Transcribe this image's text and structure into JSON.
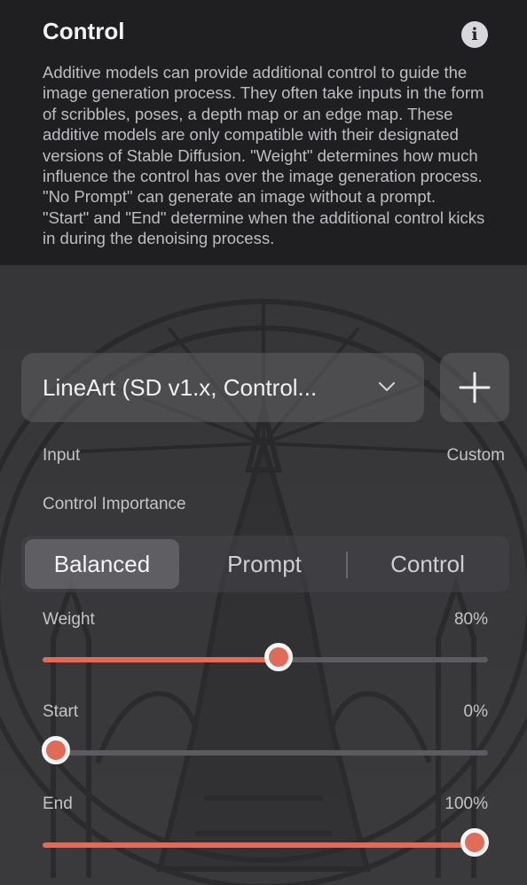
{
  "header": {
    "title": "Control",
    "info_icon": "info-icon",
    "info_glyph": "i"
  },
  "description": "Additive models can provide additional control to guide the image generation process. They often take inputs in the form of scribbles, poses, a depth map or an edge map. These additive models are only compatible with their designated versions of Stable Diffusion. \"Weight\" determines how much influence the control has over the image generation process. \"No Prompt\" can generate an image without a prompt. \"Start\" and \"End\" determine when the additional control kicks in during the denoising process.",
  "model_select": {
    "value": "LineArt (SD v1.x, Control...",
    "icon": "chevron-down-icon"
  },
  "add_button": {
    "icon": "plus-icon"
  },
  "input_row": {
    "label": "Input",
    "value": "Custom"
  },
  "importance": {
    "label": "Control Importance",
    "options": [
      "Balanced",
      "Prompt",
      "Control"
    ],
    "selected": "Balanced"
  },
  "sliders": {
    "weight": {
      "label": "Weight",
      "display": "80%",
      "value": 0.53
    },
    "start": {
      "label": "Start",
      "display": "0%",
      "value": 0.03
    },
    "end": {
      "label": "End",
      "display": "100%",
      "value": 0.97
    }
  },
  "colors": {
    "accent": "#e06b58",
    "background": "#1f1f21",
    "control_bg": "#5f5f63"
  }
}
